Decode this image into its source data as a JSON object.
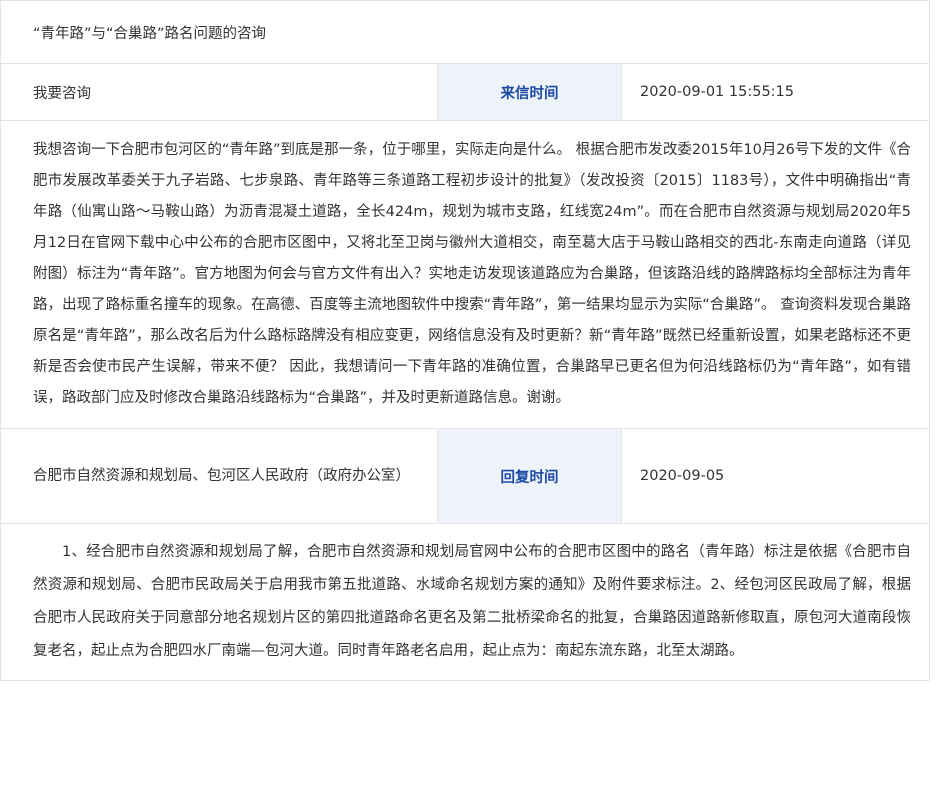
{
  "title": "“青年路”与“合巢路”路名问题的咨询",
  "consult": {
    "type_label": "我要咨询",
    "time_label": "来信时间",
    "time_value": "2020-09-01 15:55:15",
    "content": "我想咨询一下合肥市包河区的“青年路”到底是那一条，位于哪里，实际走向是什么。 根据合肥市发改委2015年10月26号下发的文件《合肥市发展改革委关于九子岩路、七步泉路、青年路等三条道路工程初步设计的批复》（发改投资〔2015〕1183号），文件中明确指出“青年路（仙寓山路～马鞍山路）为沥青混凝土道路，全长424m，规划为城市支路，红线宽24m”。而在合肥市自然资源与规划局2020年5月12日在官网下载中心中公布的合肥市区图中，又将北至卫岗与徽州大道相交，南至葛大店于马鞍山路相交的西北-东南走向道路（详见附图）标注为“青年路”。官方地图为何会与官方文件有出入？实地走访发现该道路应为合巢路，但该路沿线的路牌路标均全部标注为青年路，出现了路标重名撞车的现象。在高德、百度等主流地图软件中搜索“青年路”，第一结果均显示为实际“合巢路”。 查询资料发现合巢路原名是“青年路”，那么改名后为什么路标路牌没有相应变更，网络信息没有及时更新？新“青年路”既然已经重新设置，如果老路标还不更新是否会使市民产生误解，带来不便？ 因此，我想请问一下青年路的准确位置，合巢路早已更名但为何沿线路标仍为“青年路”，如有错误，路政部门应及时修改合巢路沿线路标为“合巢路”，并及时更新道路信息。谢谢。"
  },
  "reply": {
    "from": "合肥市自然资源和规划局、包河区人民政府（政府办公室）",
    "time_label": "回复时间",
    "time_value": "2020-09-05",
    "content": "1、经合肥市自然资源和规划局了解，合肥市自然资源和规划局官网中公布的合肥市区图中的路名（青年路）标注是依据《合肥市自然资源和规划局、合肥市民政局关于启用我市第五批道路、水域命名规划方案的通知》及附件要求标注。2、经包河区民政局了解，根据合肥市人民政府关于同意部分地名规划片区的第四批道路命名更名及第二批桥梁命名的批复，合巢路因道路新修取直，原包河大道南段恢复老名，起止点为合肥四水厂南端—包河大道。同时青年路老名启用，起止点为：南起东流东路，北至太湖路。"
  }
}
